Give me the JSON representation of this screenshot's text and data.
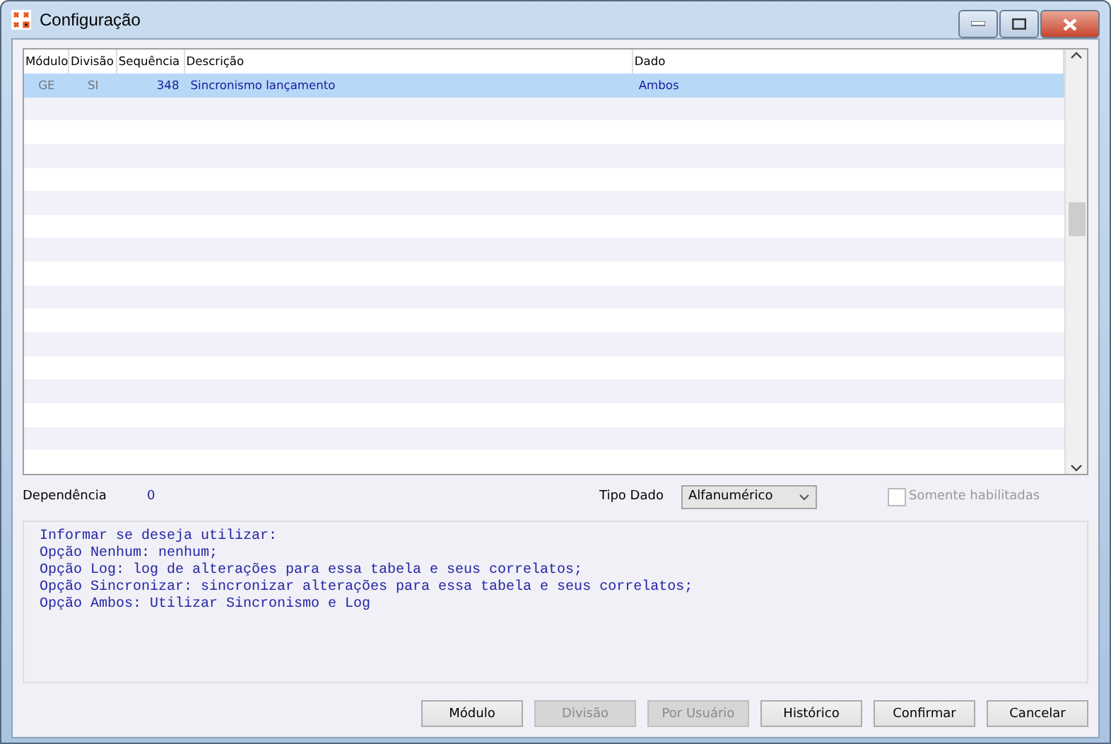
{
  "window": {
    "title": "Configuração"
  },
  "table": {
    "columns": [
      "Módulo",
      "Divisão",
      "Sequência",
      "Descrição",
      "Dado"
    ],
    "rows": [
      {
        "cells": [
          "GE",
          "SI",
          "348",
          "Sincronismo lançamento",
          "Ambos"
        ],
        "selected": true
      }
    ]
  },
  "dependencia": {
    "label": "Dependência",
    "value": "0"
  },
  "tipo_dado": {
    "label": "Tipo Dado",
    "value": "Alfanumérico"
  },
  "somente_habilitadas": {
    "label": "Somente habilitadas",
    "checked": false,
    "disabled": true
  },
  "description": [
    "Informar se deseja utilizar:",
    "Opção Nenhum: nenhum;",
    "Opção Log: log de alterações para essa tabela e seus correlatos;",
    "Opção Sincronizar: sincronizar alterações para essa tabela e seus correlatos;",
    "Opção Ambos: Utilizar Sincronismo e Log"
  ],
  "buttons": [
    {
      "label": "Módulo",
      "disabled": false
    },
    {
      "label": "Divisão",
      "disabled": true
    },
    {
      "label": "Por Usuário",
      "disabled": true
    },
    {
      "label": "Histórico",
      "disabled": false
    },
    {
      "label": "Confirmar",
      "disabled": false
    },
    {
      "label": "Cancelar",
      "disabled": false
    }
  ]
}
